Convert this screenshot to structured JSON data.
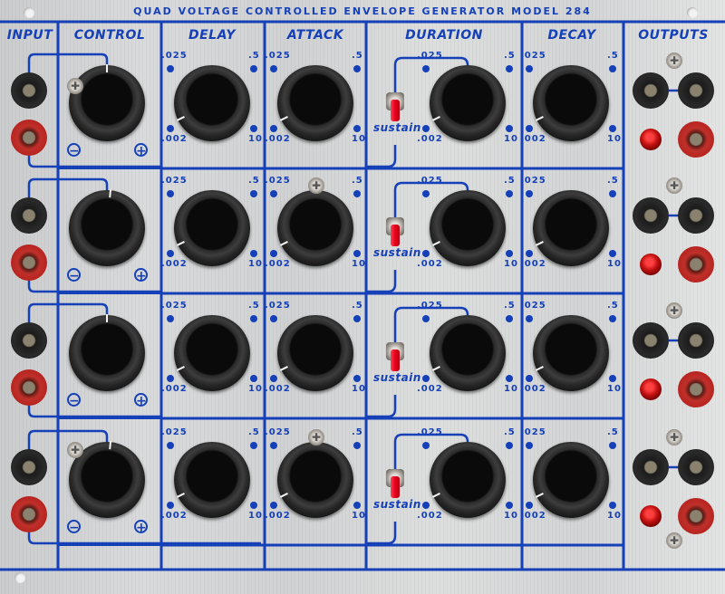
{
  "panel": {
    "title": "QUAD VOLTAGE CONTROLLED ENVELOPE GENERATOR MODEL 284",
    "model": "284",
    "accent_color": "#1540b8"
  },
  "headers": {
    "input": "INPUT",
    "control": "CONTROL",
    "delay": "DELAY",
    "attack": "ATTACK",
    "duration": "DURATION",
    "decay": "DECAY",
    "outputs": "OUTPUTS"
  },
  "scale": {
    "top_left": ".025",
    "top_right": ".5",
    "bottom_left": ".002",
    "bottom_right": "10"
  },
  "control_scale": {
    "minus": "−",
    "plus": "+"
  },
  "sustain_label": "sustain",
  "channels": [
    {
      "control_pos": 0.5,
      "delay_pos": 0.07,
      "attack_pos": 0.07,
      "duration_pos": 0.07,
      "decay_pos": 0.07,
      "sustain": "on"
    },
    {
      "control_pos": 0.52,
      "delay_pos": 0.07,
      "attack_pos": 0.07,
      "duration_pos": 0.07,
      "decay_pos": 0.07,
      "sustain": "on"
    },
    {
      "control_pos": 0.5,
      "delay_pos": 0.07,
      "attack_pos": 0.07,
      "duration_pos": 0.07,
      "decay_pos": 0.07,
      "sustain": "on"
    },
    {
      "control_pos": 0.52,
      "delay_pos": 0.07,
      "attack_pos": 0.07,
      "duration_pos": 0.07,
      "decay_pos": 0.07,
      "sustain": "on"
    }
  ],
  "icons": {
    "screw": "screw-icon",
    "jack_black": "banana-jack-black",
    "jack_red": "banana-jack-red",
    "lamp": "indicator-lamp",
    "toggle": "toggle-switch"
  }
}
